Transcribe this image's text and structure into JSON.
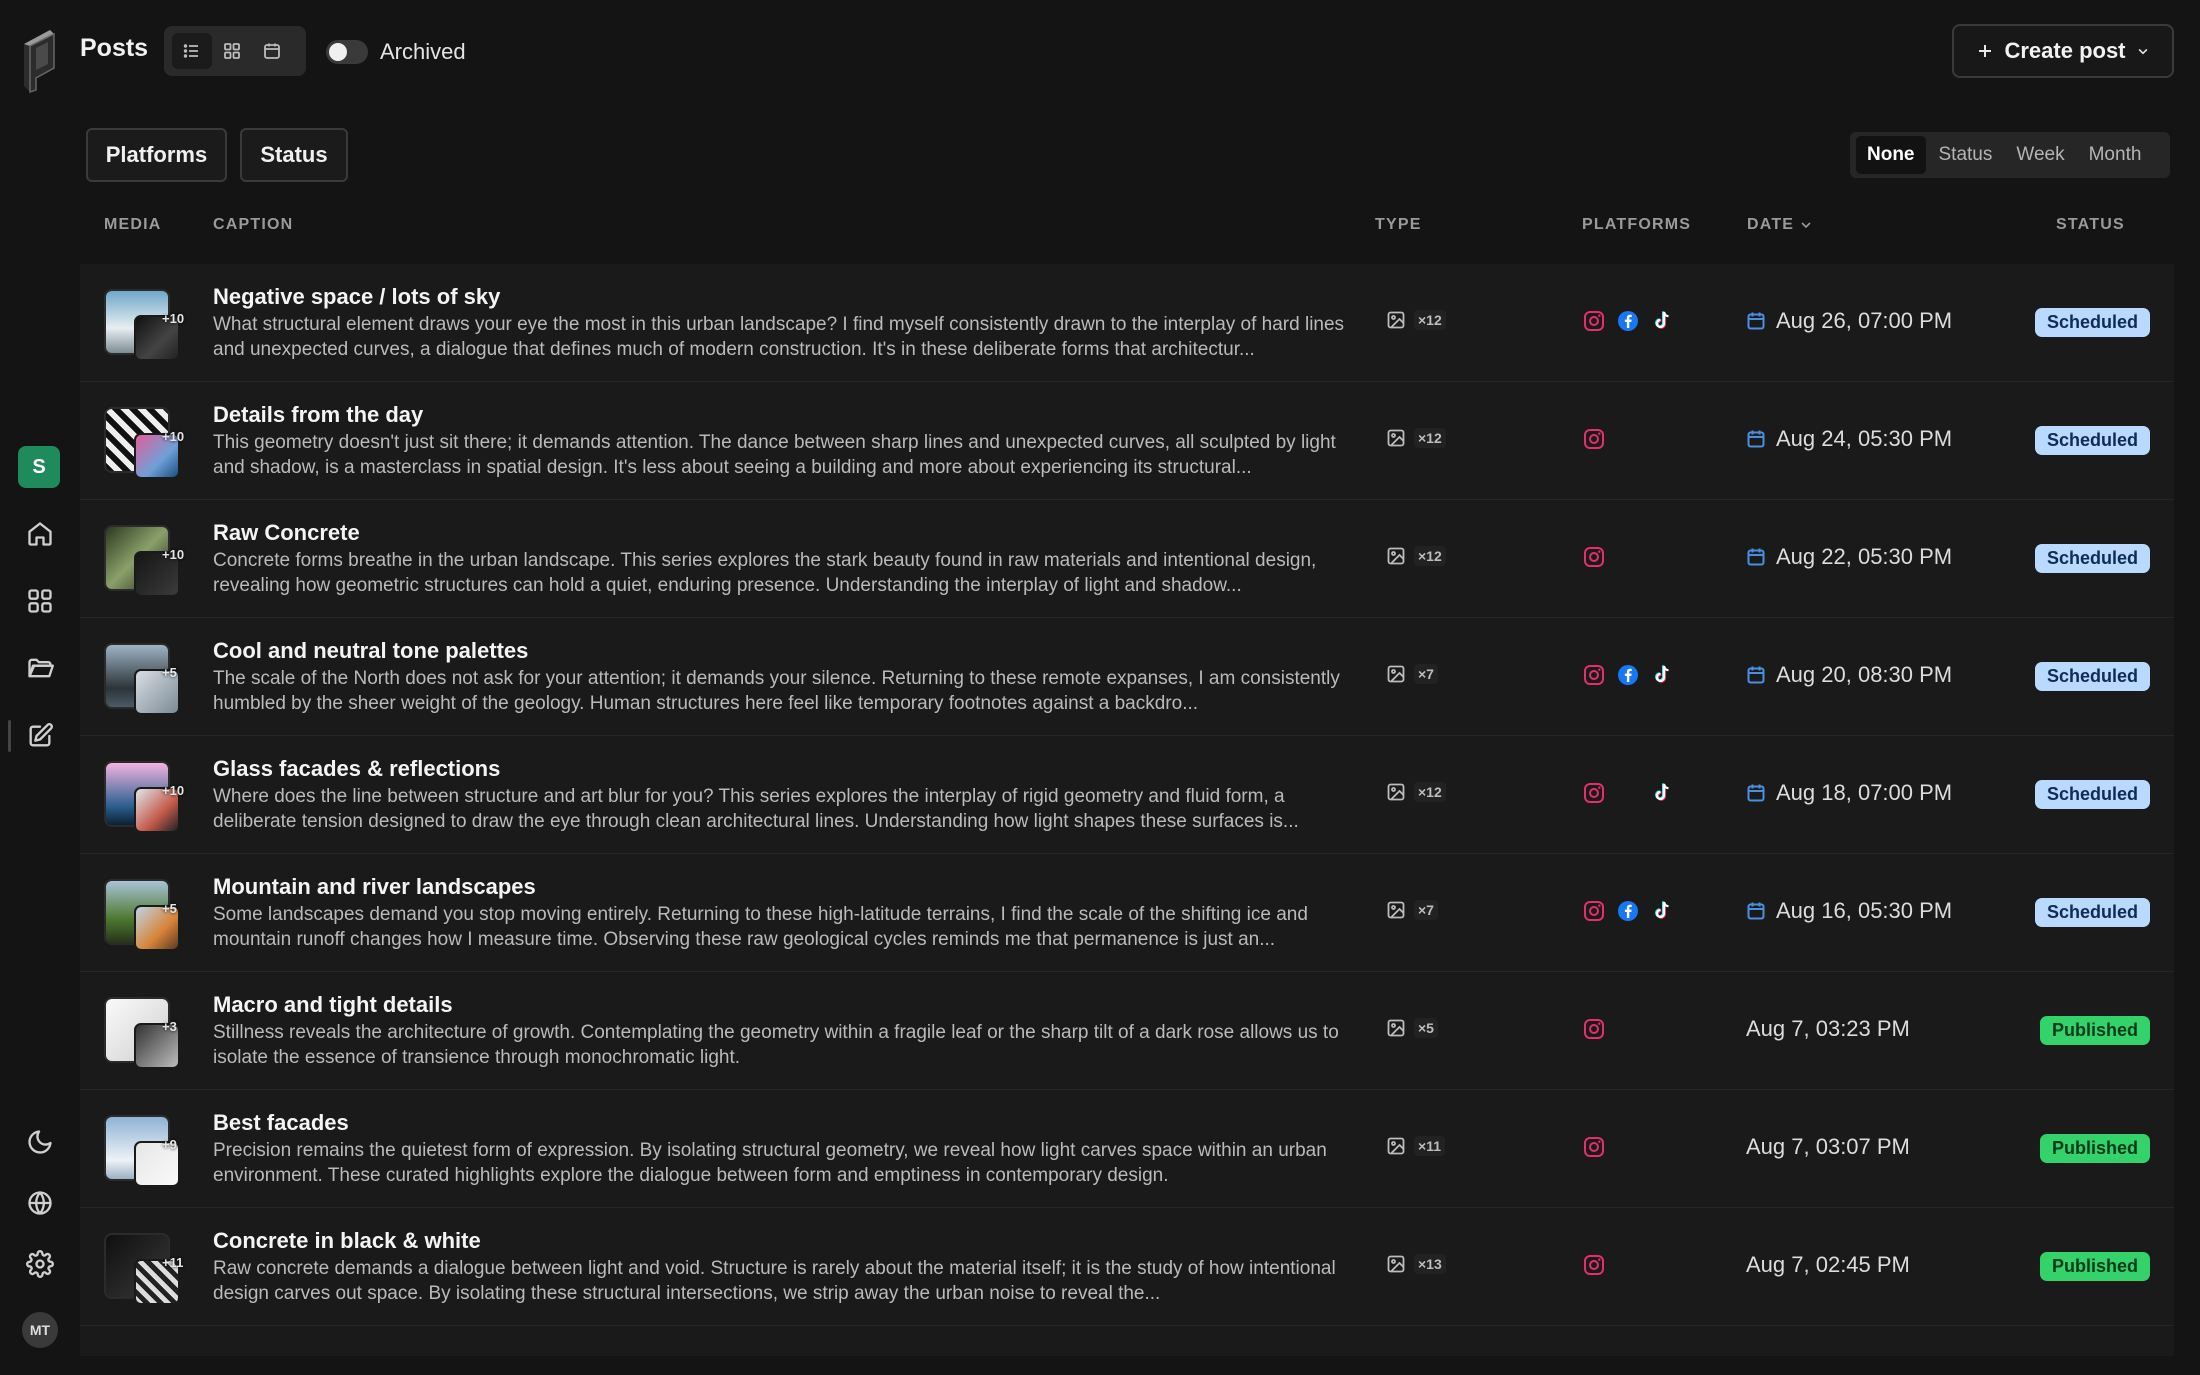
{
  "header": {
    "title": "Posts",
    "archived_label": "Archived",
    "create_label": "Create post"
  },
  "filters": {
    "platforms_label": "Platforms",
    "status_label": "Status"
  },
  "group_by": {
    "options": [
      "None",
      "Status",
      "Week",
      "Month"
    ],
    "selected": "None"
  },
  "columns": {
    "media": "MEDIA",
    "caption": "CAPTION",
    "type": "TYPE",
    "platforms": "PLATFORMS",
    "date": "DATE",
    "status": "STATUS"
  },
  "sidebar": {
    "workspace_initial": "S",
    "avatar_initials": "MT"
  },
  "colors": {
    "accent_workspace": "#1f8a5b",
    "scheduled_badge": "#b9d9ff",
    "published_badge": "#33d26a",
    "instagram": "#e1306c",
    "facebook": "#1877f2"
  },
  "posts": [
    {
      "title": "Negative space / lots of sky",
      "caption": "What structural element draws your eye the most in this urban landscape? I find myself consistently drawn to the interplay of hard lines and unexpected curves, a dialogue that defines much of modern construction. It's in these deliberate forms that architectur...",
      "extra": "+10",
      "media_count": "×12",
      "instagram": true,
      "facebook": true,
      "tiktok": true,
      "date": "Aug 26, 07:00 PM",
      "status": "Scheduled"
    },
    {
      "title": "Details from the day",
      "caption": "This geometry doesn't just sit there; it demands attention. The dance between sharp lines and unexpected curves, all sculpted by light and shadow, is a masterclass in spatial design. It's less about seeing a building and more about experiencing its structural...",
      "extra": "+10",
      "media_count": "×12",
      "instagram": true,
      "facebook": false,
      "tiktok": false,
      "date": "Aug 24, 05:30 PM",
      "status": "Scheduled"
    },
    {
      "title": "Raw Concrete",
      "caption": "Concrete forms breathe in the urban landscape. This series explores the stark beauty found in raw materials and intentional design, revealing how geometric structures can hold a quiet, enduring presence. Understanding the interplay of light and shadow...",
      "extra": "+10",
      "media_count": "×12",
      "instagram": true,
      "facebook": false,
      "tiktok": false,
      "date": "Aug 22, 05:30 PM",
      "status": "Scheduled"
    },
    {
      "title": "Cool and neutral tone palettes",
      "caption": "The scale of the North does not ask for your attention; it demands your silence. Returning to these remote expanses, I am consistently humbled by the sheer weight of the geology. Human structures here feel like temporary footnotes against a backdro...",
      "extra": "+5",
      "media_count": "×7",
      "instagram": true,
      "facebook": true,
      "tiktok": true,
      "date": "Aug 20, 08:30 PM",
      "status": "Scheduled"
    },
    {
      "title": "Glass facades & reflections",
      "caption": "Where does the line between structure and art blur for you? This series explores the interplay of rigid geometry and fluid form, a deliberate tension designed to draw the eye through clean architectural lines. Understanding how light shapes these surfaces is...",
      "extra": "+10",
      "media_count": "×12",
      "instagram": true,
      "facebook": false,
      "tiktok": true,
      "date": "Aug 18, 07:00 PM",
      "status": "Scheduled"
    },
    {
      "title": "Mountain and river landscapes",
      "caption": "Some landscapes demand you stop moving entirely. Returning to these high-latitude terrains, I find the scale of the shifting ice and mountain runoff changes how I measure time. Observing these raw geological cycles reminds me that permanence is just an...",
      "extra": "+5",
      "media_count": "×7",
      "instagram": true,
      "facebook": true,
      "tiktok": true,
      "date": "Aug 16, 05:30 PM",
      "status": "Scheduled"
    },
    {
      "title": "Macro and tight details",
      "caption": "Stillness reveals the architecture of growth. Contemplating the geometry within a fragile leaf or the sharp tilt of a dark rose allows us to isolate the essence of transience through monochromatic light.",
      "extra": "+3",
      "media_count": "×5",
      "instagram": true,
      "facebook": false,
      "tiktok": false,
      "date": "Aug 7, 03:23 PM",
      "status": "Published"
    },
    {
      "title": "Best facades",
      "caption": "Precision remains the quietest form of expression. By isolating structural geometry, we reveal how light carves space within an urban environment. These curated highlights explore the dialogue between form and emptiness in contemporary design.",
      "extra": "+9",
      "media_count": "×11",
      "instagram": true,
      "facebook": false,
      "tiktok": false,
      "date": "Aug 7, 03:07 PM",
      "status": "Published"
    },
    {
      "title": "Concrete in black & white",
      "caption": "Raw concrete demands a dialogue between light and void. Structure is rarely about the material itself; it is the study of how intentional design carves out space. By isolating these structural intersections, we strip away the urban noise to reveal the...",
      "extra": "+11",
      "media_count": "×13",
      "instagram": true,
      "facebook": false,
      "tiktok": false,
      "date": "Aug 7, 02:45 PM",
      "status": "Published"
    }
  ]
}
